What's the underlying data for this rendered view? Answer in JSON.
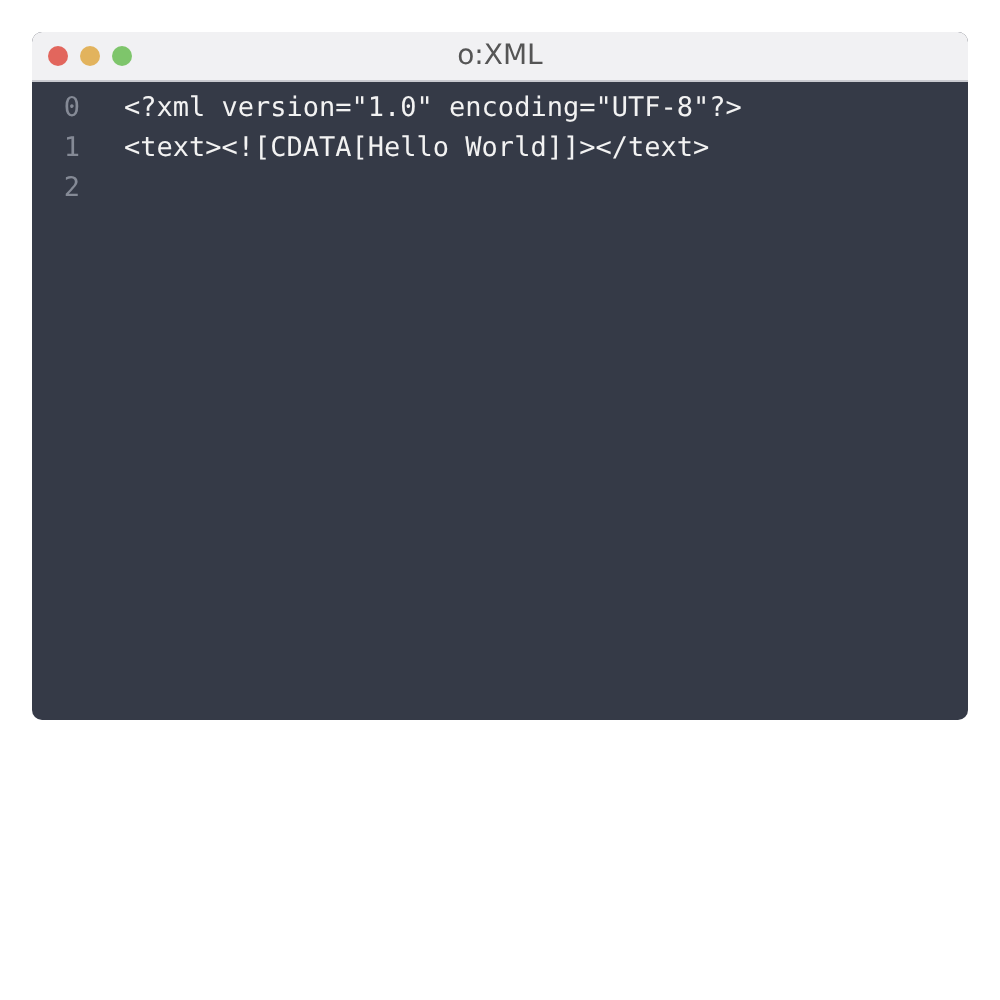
{
  "window": {
    "title": "o:XML"
  },
  "editor": {
    "lines": [
      {
        "number": "0",
        "code": "<?xml version=\"1.0\" encoding=\"UTF-8\"?>"
      },
      {
        "number": "1",
        "code": "<text><![CDATA[Hello World]]></text>"
      },
      {
        "number": "2"
      }
    ]
  }
}
